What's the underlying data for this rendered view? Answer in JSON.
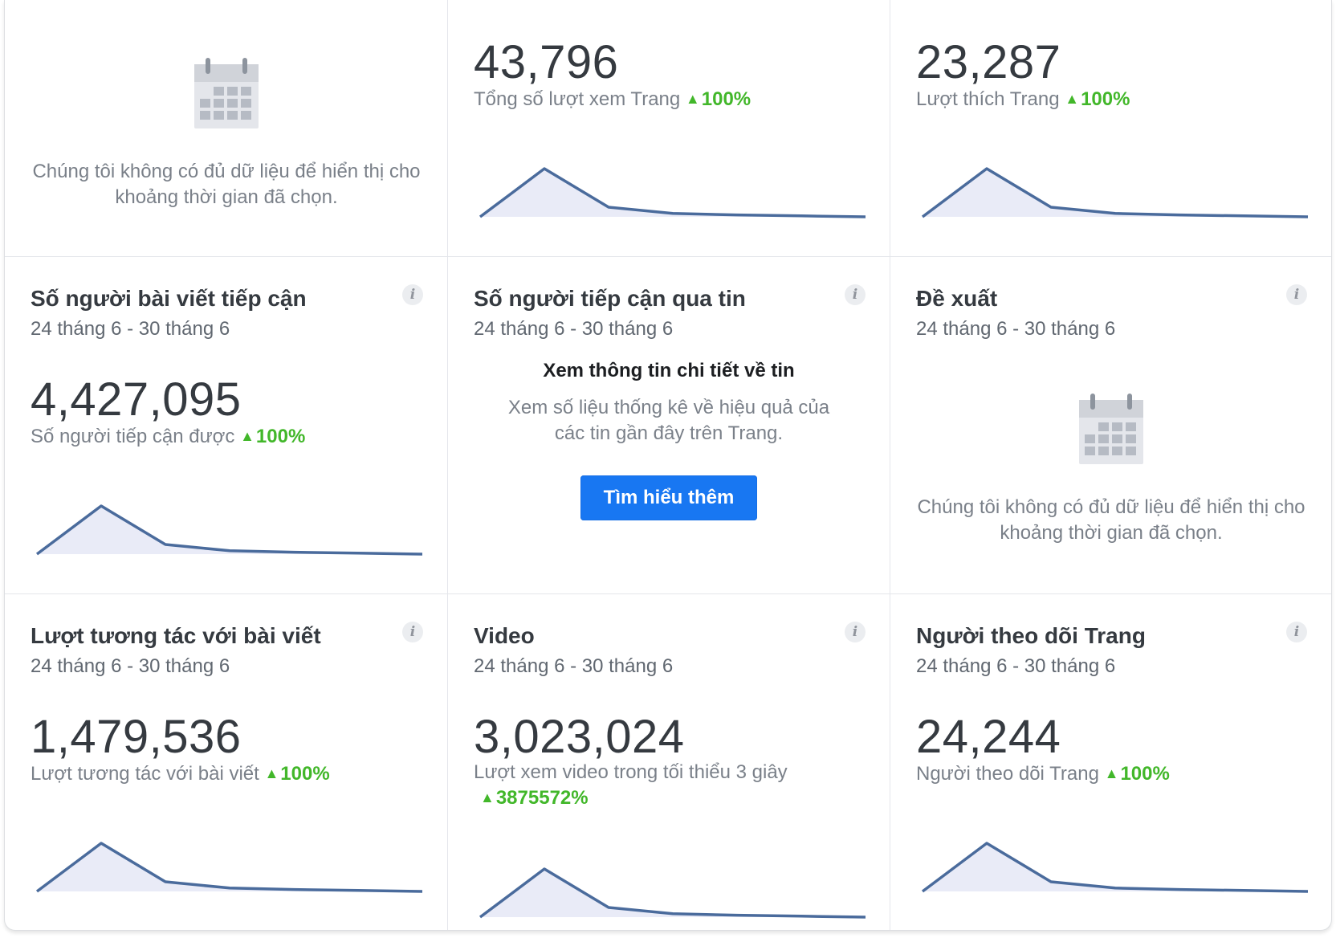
{
  "cards": {
    "c1": {
      "no_data_text": "Chúng tôi không có đủ dữ liệu để hiển thị cho khoảng thời gian đã chọn."
    },
    "c2": {
      "value": "43,796",
      "metric_label": "Tổng số lượt xem Trang",
      "change": "100%"
    },
    "c3": {
      "value": "23,287",
      "metric_label": "Lượt thích Trang",
      "change": "100%"
    },
    "c4": {
      "title": "Số người bài viết tiếp cận",
      "date_range": "24 tháng 6 - 30 tháng 6",
      "value": "4,427,095",
      "metric_label": "Số người tiếp cận được",
      "change": "100%"
    },
    "c5": {
      "title": "Số người tiếp cận qua tin",
      "date_range": "24 tháng 6 - 30 tháng 6",
      "promo_title": "Xem thông tin chi tiết về tin",
      "promo_desc": "Xem số liệu thống kê về hiệu quả của các tin gần đây trên Trang.",
      "button_label": "Tìm hiểu thêm"
    },
    "c6": {
      "title": "Đề xuất",
      "date_range": "24 tháng 6 - 30 tháng 6",
      "no_data_text": "Chúng tôi không có đủ dữ liệu để hiển thị cho khoảng thời gian đã chọn."
    },
    "c7": {
      "title": "Lượt tương tác với bài viết",
      "date_range": "24 tháng 6 - 30 tháng 6",
      "value": "1,479,536",
      "metric_label": "Lượt tương tác với bài viết",
      "change": "100%"
    },
    "c8": {
      "title": "Video",
      "date_range": "24 tháng 6 - 30 tháng 6",
      "value": "3,023,024",
      "metric_label": "Lượt xem video trong tối thiểu 3 giây",
      "change": "3875572%"
    },
    "c9": {
      "title": "Người theo dõi Trang",
      "date_range": "24 tháng 6 - 30 tháng 6",
      "value": "24,244",
      "metric_label": "Người theo dõi Trang",
      "change": "100%"
    }
  },
  "info_icon_glyph": "i",
  "up_arrow_glyph": "▲",
  "icons": {
    "info": "info-icon",
    "up_arrow": "up-arrow-icon",
    "no_data": "calendar-icon"
  },
  "colors": {
    "accent_blue": "#1877f2",
    "positive_green": "#42b72a",
    "sparkline_stroke": "#4a6b9c",
    "sparkline_fill": "#e9ebf7"
  },
  "sparkline_values": [
    0,
    1.0,
    0.2,
    0.07,
    0.04,
    0.02,
    0.0
  ]
}
